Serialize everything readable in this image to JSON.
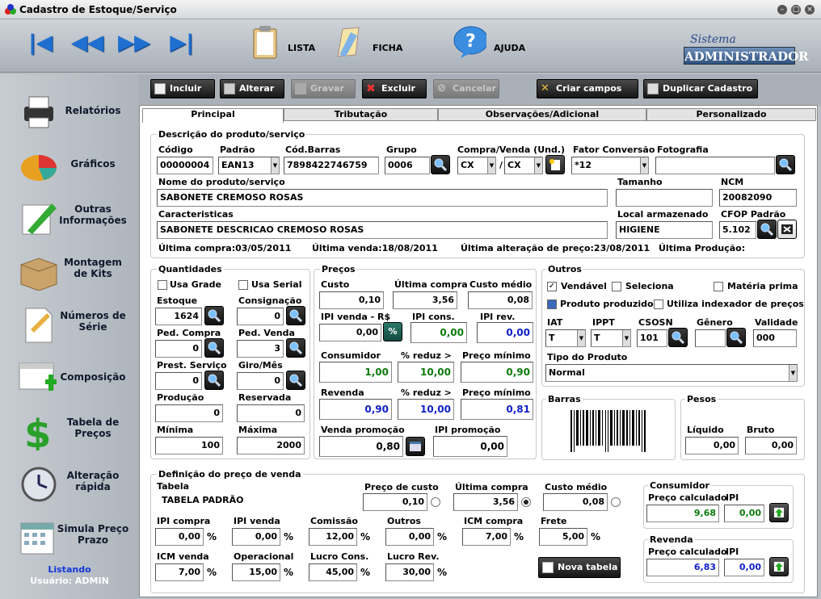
{
  "window": {
    "title": "Cadastro de Estoque/Serviço"
  },
  "toolbar": {
    "lista": "LISTA",
    "ficha": "FICHA",
    "ajuda": "AJUDA",
    "brand_top": "Sistema",
    "brand_bottom": "ADMINISTRADOR"
  },
  "sidebar": {
    "items": [
      {
        "label": "Relatórios"
      },
      {
        "label": "Gráficos"
      },
      {
        "label": "Outras Informações"
      },
      {
        "label": "Montagem de Kits"
      },
      {
        "label": "Números de Série"
      },
      {
        "label": "Composição"
      },
      {
        "label": "Tabela de Preços"
      },
      {
        "label": "Alteração rápida"
      },
      {
        "label": "Simula Preço Prazo"
      }
    ],
    "status": "Listando",
    "user": "Usuário: ADMIN"
  },
  "actions": {
    "incluir": "Incluir",
    "alterar": "Alterar",
    "gravar": "Gravar",
    "excluir": "Excluir",
    "cancelar": "Cancelar",
    "criar": "Criar campos",
    "duplicar": "Duplicar Cadastro"
  },
  "tabs": [
    "Principal",
    "Tributação",
    "Observações/Adicional",
    "Personalizado"
  ],
  "desc": {
    "legend": "Descrição do produto/serviço",
    "codigo_l": "Código",
    "codigo": "00000004",
    "padrao_l": "Padrão",
    "padrao": "EAN13",
    "barras_l": "Cód.Barras",
    "barras": "7898422746759",
    "grupo_l": "Grupo",
    "grupo": "0006",
    "cv_l": "Compra/Venda (Und.)",
    "compra": "CX",
    "venda": "CX",
    "slash": "/",
    "fator_l": "Fator Conversão",
    "fator": "*12",
    "foto_l": "Fotografia",
    "nome_l": "Nome do produto/serviço",
    "nome": "SABONETE CREMOSO ROSAS",
    "tamanho_l": "Tamanho",
    "ncm_l": "NCM",
    "ncm": "20082090",
    "carac_l": "Caracteristicas",
    "carac": "SABONETE DESCRICAO CREMOSO ROSAS",
    "local_l": "Local armazenado",
    "local": "HIGIENE",
    "cfop_l": "CFOP Padrão",
    "cfop": "5.102",
    "ult_compra": "Última compra:03/05/2011",
    "ult_venda": "Última venda:18/08/2011",
    "ult_alt": "Última alteração de preço:23/08/2011",
    "ult_prod": "Última Produção:"
  },
  "qtd": {
    "legend": "Quantidades",
    "grade": "Usa Grade",
    "serial": "Usa Serial",
    "estoque_l": "Estoque",
    "estoque": "1624",
    "consig_l": "Consignação",
    "consig": "0",
    "pedc_l": "Ped. Compra",
    "pedc": "0",
    "pedv_l": "Ped. Venda",
    "pedv": "3",
    "prest_l": "Prest. Serviço",
    "prest": "0",
    "giro_l": "Giro/Mês",
    "giro": "0",
    "prod_l": "Produção",
    "prod": "0",
    "res_l": "Reservada",
    "res": "0",
    "min_l": "Mínima",
    "min": "100",
    "max_l": "Máxima",
    "max": "2000"
  },
  "precos": {
    "legend": "Preços",
    "custo_l": "Custo",
    "custo": "0,10",
    "ultc_l": "Última compra",
    "ultc": "3,56",
    "cmed_l": "Custo médio",
    "cmed": "0,08",
    "ipiv_l": "IPI venda - R$",
    "ipiv": "0,00",
    "pct_sym": "%",
    "ipic_l": "IPI cons.",
    "ipic": "0,00",
    "ipir_l": "IPI rev.",
    "ipir": "0,00",
    "cons_l": "Consumidor",
    "cons": "1,00",
    "redc_l": "% reduz >",
    "redc": "10,00",
    "pminc_l": "Preço mínimo",
    "pminc": "0,90",
    "rev_l": "Revenda",
    "rev": "0,90",
    "redr_l": "% reduz >",
    "redr": "10,00",
    "pminr_l": "Preço mínimo",
    "pminr": "0,81",
    "vp_l": "Venda promoção",
    "vp": "0,80",
    "ipip_l": "IPI promoção",
    "ipip": "0,00"
  },
  "outros": {
    "legend": "Outros",
    "vendavel": "Vendável",
    "seleciona": "Seleciona",
    "materia": "Matéria prima",
    "produzido": "Produto produzido",
    "indexador": "Utiliza indexador de preços",
    "iat_l": "IAT",
    "iat": "T",
    "ippt_l": "IPPT",
    "ippt": "T",
    "csosn_l": "CSOSN",
    "csosn": "101",
    "genero_l": "Gênero",
    "validade_l": "Validade",
    "validade": "000",
    "tipo_l": "Tipo do Produto",
    "tipo": "Normal",
    "barras_leg": "Barras",
    "pesos_leg": "Pesos",
    "liq_l": "Líquido",
    "liq": "0,00",
    "bruto_l": "Bruto",
    "bruto": "0,00"
  },
  "def": {
    "legend": "Definição do preço de venda",
    "tabela_l": "Tabela",
    "tabela": "TABELA PADRÃO",
    "pc_l": "Preço de custo",
    "pc": "0,10",
    "uc_l": "Última compra",
    "uc": "3,56",
    "cm_l": "Custo médio",
    "cm": "0,08",
    "ipic_l": "IPI compra",
    "ipic": "0,00",
    "ipiv_l": "IPI venda",
    "ipiv": "0,00",
    "com_l": "Comissão",
    "com": "12,00",
    "out_l": "Outros",
    "out": "0,00",
    "icmc_l": "ICM compra",
    "icmc": "7,00",
    "frete_l": "Frete",
    "frete": "5,00",
    "icmv_l": "ICM venda",
    "icmv": "7,00",
    "oper_l": "Operacional",
    "oper": "15,00",
    "lcons_l": "Lucro Cons.",
    "lcons": "45,00",
    "lrev_l": "Lucro Rev.",
    "lrev": "30,00",
    "pct": "%",
    "nova": "Nova tabela",
    "cons_leg": "Consumidor",
    "cons_pc_l": "Preço calculado",
    "cons_pc": "9,68",
    "cons_ipi_l": "IPI",
    "cons_ipi": "0,00",
    "rev_leg": "Revenda",
    "rev_pc_l": "Preço calculado",
    "rev_pc": "6,83",
    "rev_ipi_l": "IPI",
    "rev_ipi": "0,00"
  }
}
